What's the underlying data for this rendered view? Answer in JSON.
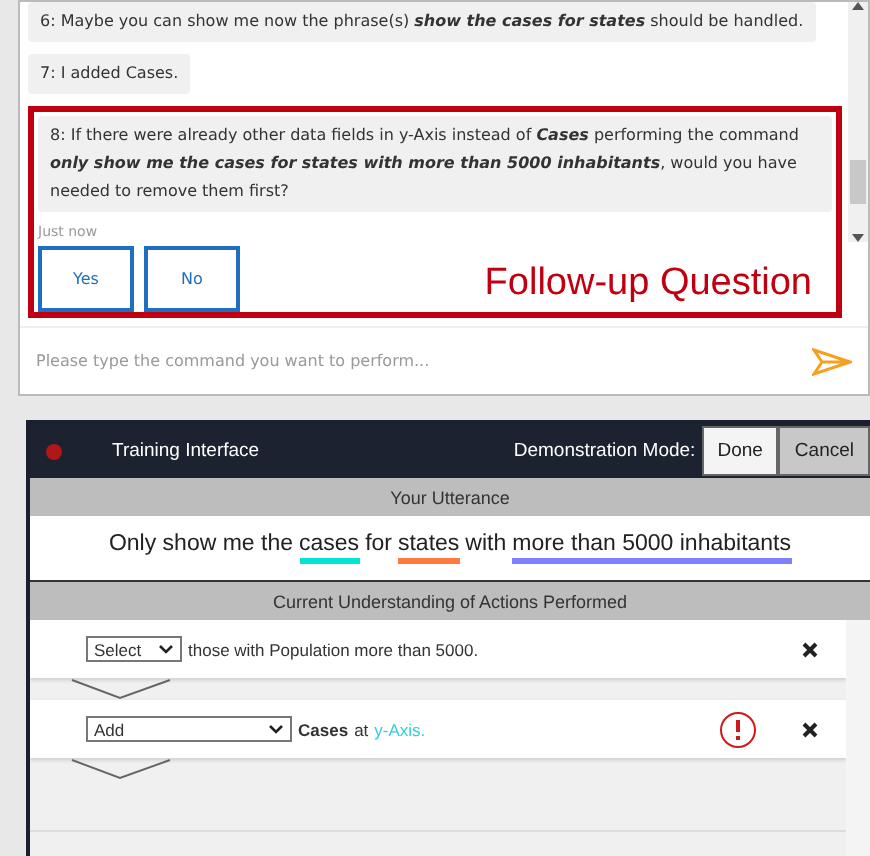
{
  "chat": {
    "messages": [
      {
        "text": "6: Maybe you can show me now the phrase(s) **show the cases for states** should be handled."
      },
      {
        "text": "7: I added Cases."
      }
    ],
    "follow_up": {
      "message": "8: If there were already other data fields in y-Axis instead of **Cases** performing the command **only show me the cases for states with more than 5000 inhabitants**, would you have needed to remove them first?",
      "time": "Just now",
      "buttons": [
        "Yes",
        "No"
      ],
      "label": "Follow-up Question"
    },
    "input": {
      "placeholder": "Please type the command you want to perform..."
    }
  },
  "training": {
    "title": "Training Interface",
    "mode_label": "Demonstration Mode:",
    "buttons": [
      "Done",
      "Cancel"
    ],
    "utterance_heading": "Your Utterance",
    "utterance": [
      {
        "text": "Only show me the"
      },
      {
        "text": "cases",
        "color": "#00e5d8"
      },
      {
        "text": "for"
      },
      {
        "text": "states",
        "color": "#ff7a3d"
      },
      {
        "text": "with"
      },
      {
        "text": "more than 5000 inhabitants",
        "color": "#8080ff"
      }
    ],
    "actions_heading": "Current Understanding of Actions Performed",
    "actions": [
      {
        "operation": "Select",
        "warning": false,
        "parts": [
          {
            "kind": "plain",
            "text": "those with Population more than 5000."
          }
        ]
      },
      {
        "operation": "Add",
        "warning": true,
        "parts": [
          {
            "kind": "bold",
            "text": "Cases"
          },
          {
            "kind": "plain",
            "text": "at"
          },
          {
            "kind": "link",
            "text": "y-Axis."
          }
        ]
      }
    ]
  }
}
